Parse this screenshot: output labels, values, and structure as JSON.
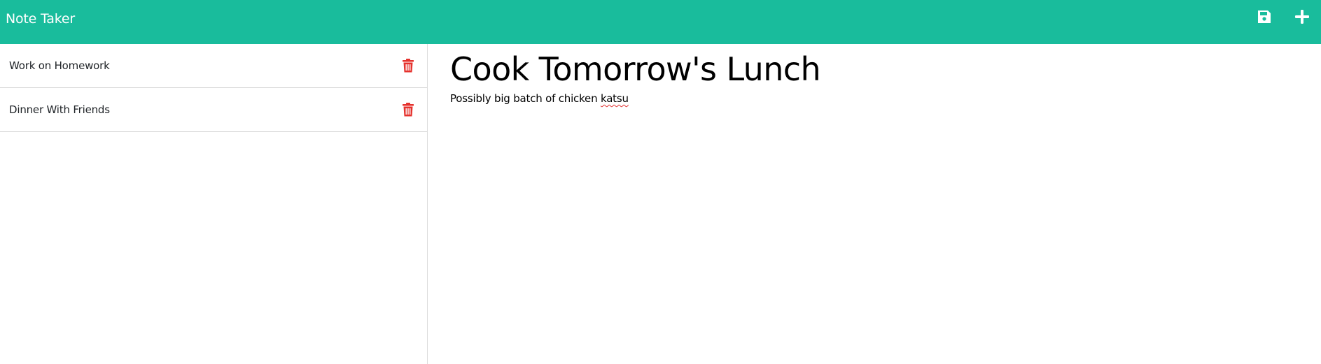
{
  "navbar": {
    "brand": "Note Taker",
    "actions": [
      {
        "icon": "save-icon"
      },
      {
        "icon": "plus-icon"
      }
    ],
    "background": "#19bc9c"
  },
  "sidebar": {
    "notes": [
      {
        "title": "Work on Homework",
        "icon": "trash-icon"
      },
      {
        "title": "Dinner With Friends",
        "icon": "trash-icon"
      }
    ],
    "delete_color": "#e5322d"
  },
  "editor": {
    "title": "Cook Tomorrow's Lunch",
    "body_prefix": "Possibly big batch of chicken ",
    "body_misspelled": "katsu"
  }
}
